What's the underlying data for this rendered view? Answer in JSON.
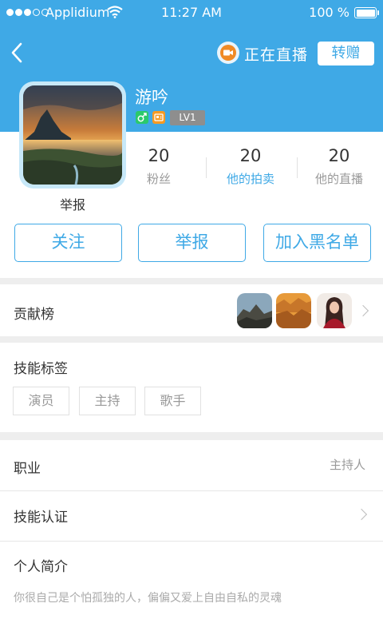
{
  "status_bar": {
    "carrier": "Applidium",
    "time": "11:27 AM",
    "battery": "100 %"
  },
  "nav": {
    "live_label": "正在直播",
    "gift_button": "转赠"
  },
  "profile": {
    "name": "游吟",
    "level": "LV1",
    "report_label": "举报",
    "stats": [
      {
        "value": "20",
        "label": "粉丝"
      },
      {
        "value": "20",
        "label": "他的拍卖"
      },
      {
        "value": "20",
        "label": "他的直播"
      }
    ]
  },
  "actions": {
    "follow": "关注",
    "report": "举报",
    "blacklist": "加入黑名单"
  },
  "contribution": {
    "label": "贡献榜"
  },
  "skills": {
    "title": "技能标签",
    "tags": [
      "演员",
      "主持",
      "歌手"
    ]
  },
  "details": {
    "occupation_label": "职业",
    "occupation_value": "主持人",
    "certification_label": "技能认证",
    "intro_label": "个人简介",
    "intro_text": "你很自己是个怕孤独的人，偏偏又爱上自由自私的灵魂"
  },
  "colors": {
    "primary": "#3fa9e6",
    "live_orange": "#f08a26",
    "gender_green": "#2bc96b"
  }
}
